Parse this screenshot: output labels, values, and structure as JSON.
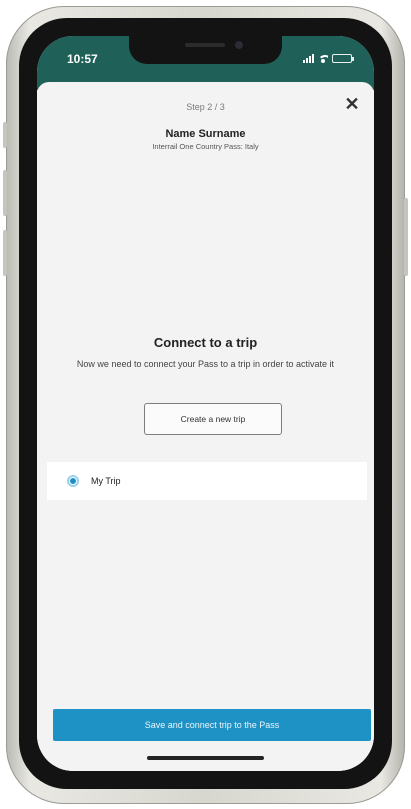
{
  "status_bar": {
    "time": "10:57",
    "icons": [
      "signal-icon",
      "wifi-icon",
      "battery-icon"
    ],
    "background_color": "#1f6158"
  },
  "header": {
    "step": "Step 2 / 3",
    "close_icon": "close-icon",
    "close_glyph": "✕",
    "name": "Name Surname",
    "pass": "Interrail One Country Pass: Italy"
  },
  "connect": {
    "title": "Connect to a trip",
    "description": "Now we need to connect your Pass to a trip in order to activate it",
    "create_button": "Create a new trip"
  },
  "trips": [
    {
      "label": "My Trip",
      "selected": true
    }
  ],
  "footer": {
    "save_button": "Save and connect trip to the Pass",
    "accent_color": "#1e91c5"
  }
}
